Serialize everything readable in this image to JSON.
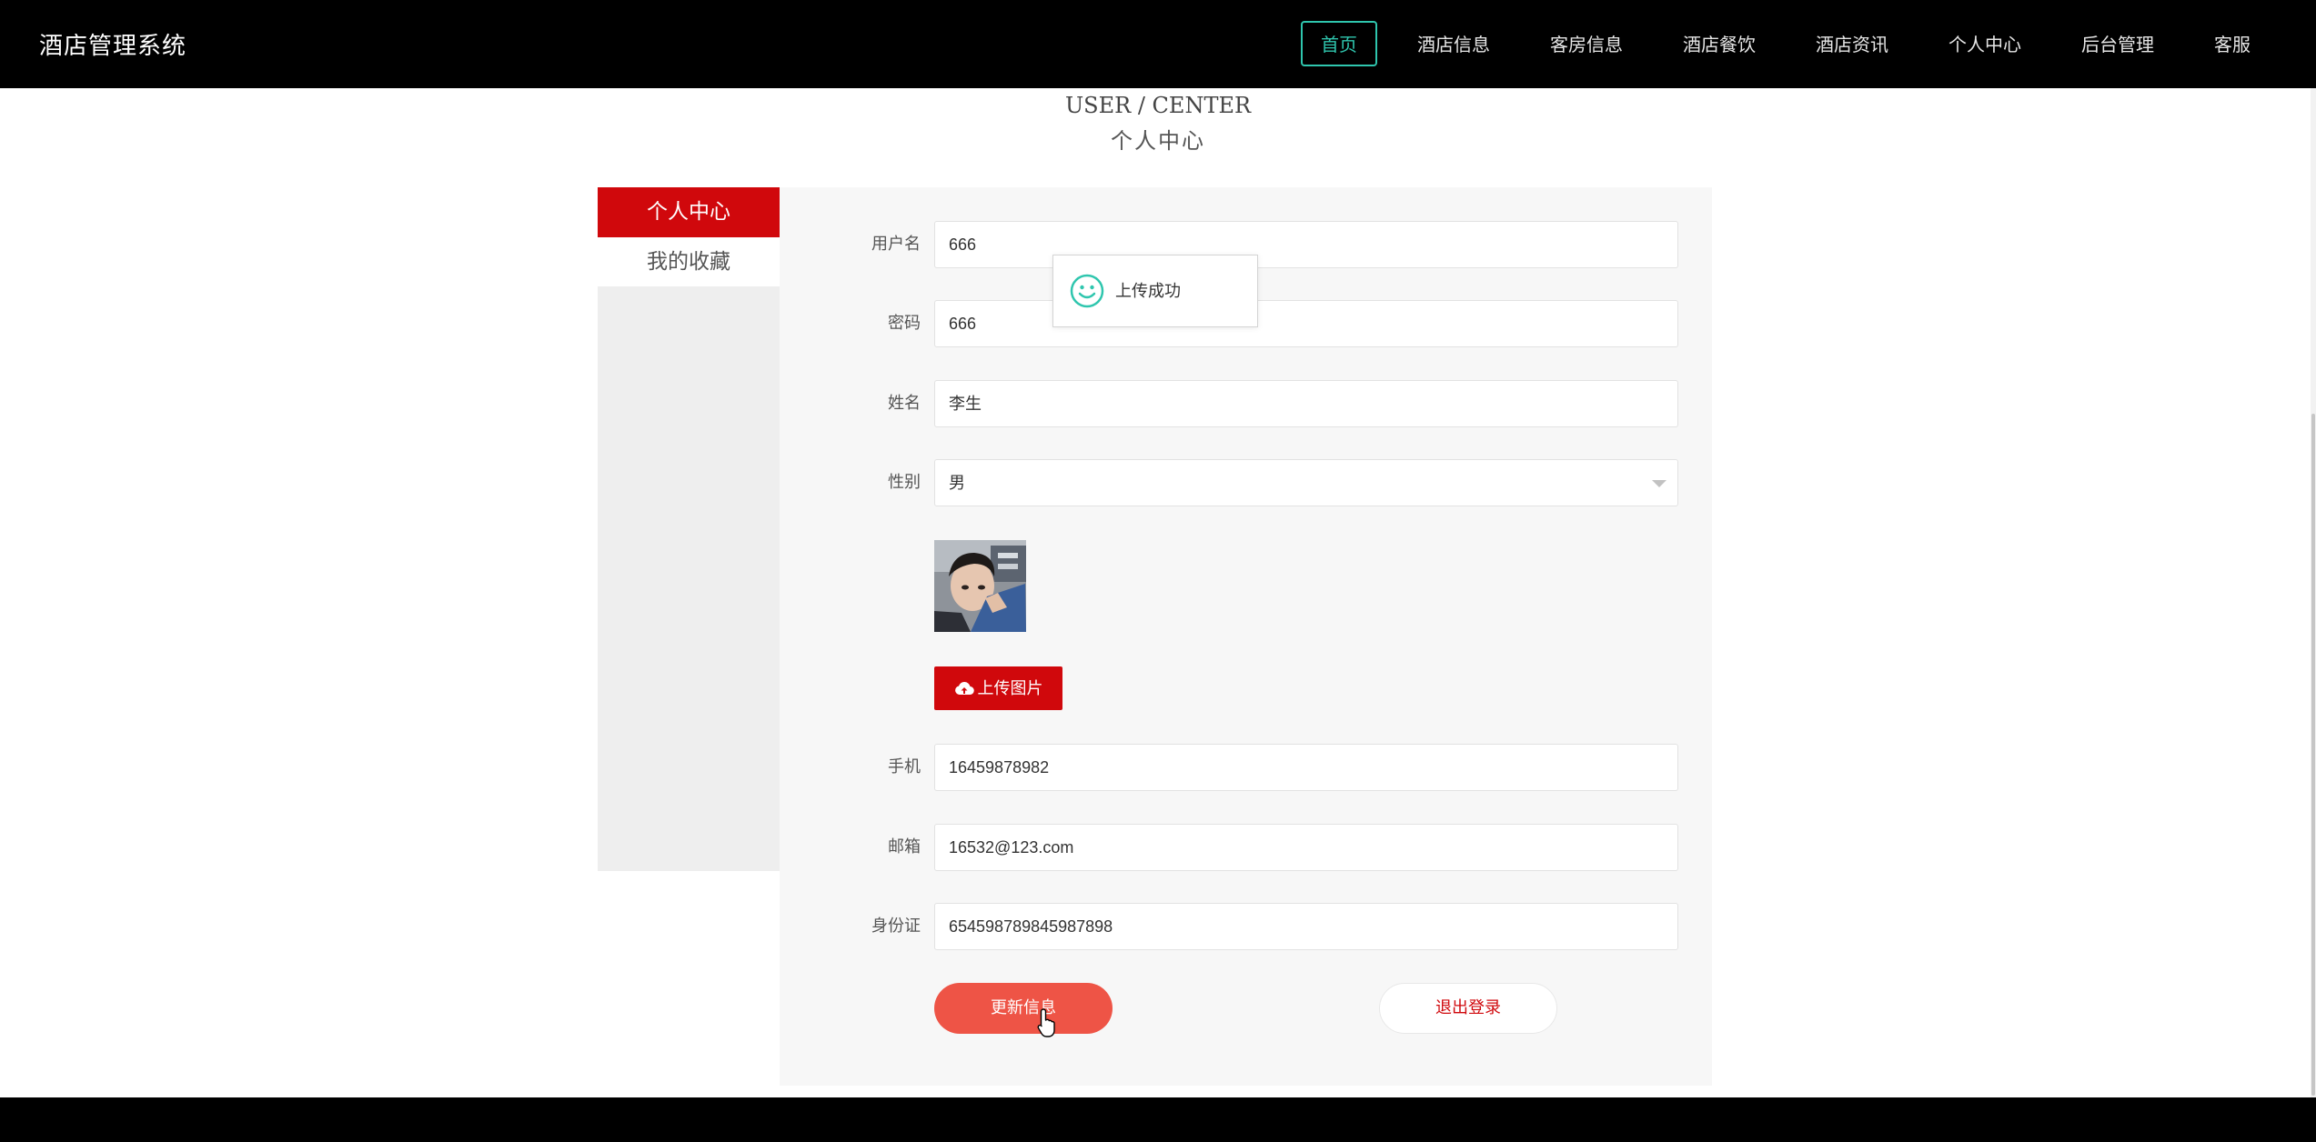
{
  "app": {
    "title": "酒店管理系统"
  },
  "nav": {
    "items": [
      {
        "label": "首页",
        "active": true
      },
      {
        "label": "酒店信息"
      },
      {
        "label": "客房信息"
      },
      {
        "label": "酒店餐饮"
      },
      {
        "label": "酒店资讯"
      },
      {
        "label": "个人中心"
      },
      {
        "label": "后台管理"
      },
      {
        "label": "客服"
      }
    ],
    "accent_color": "#2fc6ae"
  },
  "heading": {
    "en": "USER / CENTER",
    "zh": "个人中心"
  },
  "side_menu": {
    "items": [
      {
        "label": "个人中心",
        "active": true
      },
      {
        "label": "我的收藏"
      }
    ],
    "active_color": "#d0080c"
  },
  "form": {
    "username": {
      "label": "用户名",
      "value": "666"
    },
    "password": {
      "label": "密码",
      "value": "666"
    },
    "name": {
      "label": "姓名",
      "value": "李生"
    },
    "gender": {
      "label": "性别",
      "value": "男"
    },
    "avatar": {
      "icon": "avatar-photo"
    },
    "upload_button": {
      "label": "上传图片",
      "icon": "cloud-upload-icon"
    },
    "phone": {
      "label": "手机",
      "value": "16459878982"
    },
    "email": {
      "label": "邮箱",
      "value": "16532@123.com"
    },
    "id_card": {
      "label": "身份证",
      "value": "654598789845987898"
    },
    "update_button": {
      "label": "更新信息"
    },
    "logout_button": {
      "label": "退出登录"
    }
  },
  "toast": {
    "message": "上传成功",
    "icon": "smile-icon",
    "color": "#2fc6ae"
  },
  "colors": {
    "primary_red": "#d0080c",
    "update_button": "#ee5446"
  }
}
